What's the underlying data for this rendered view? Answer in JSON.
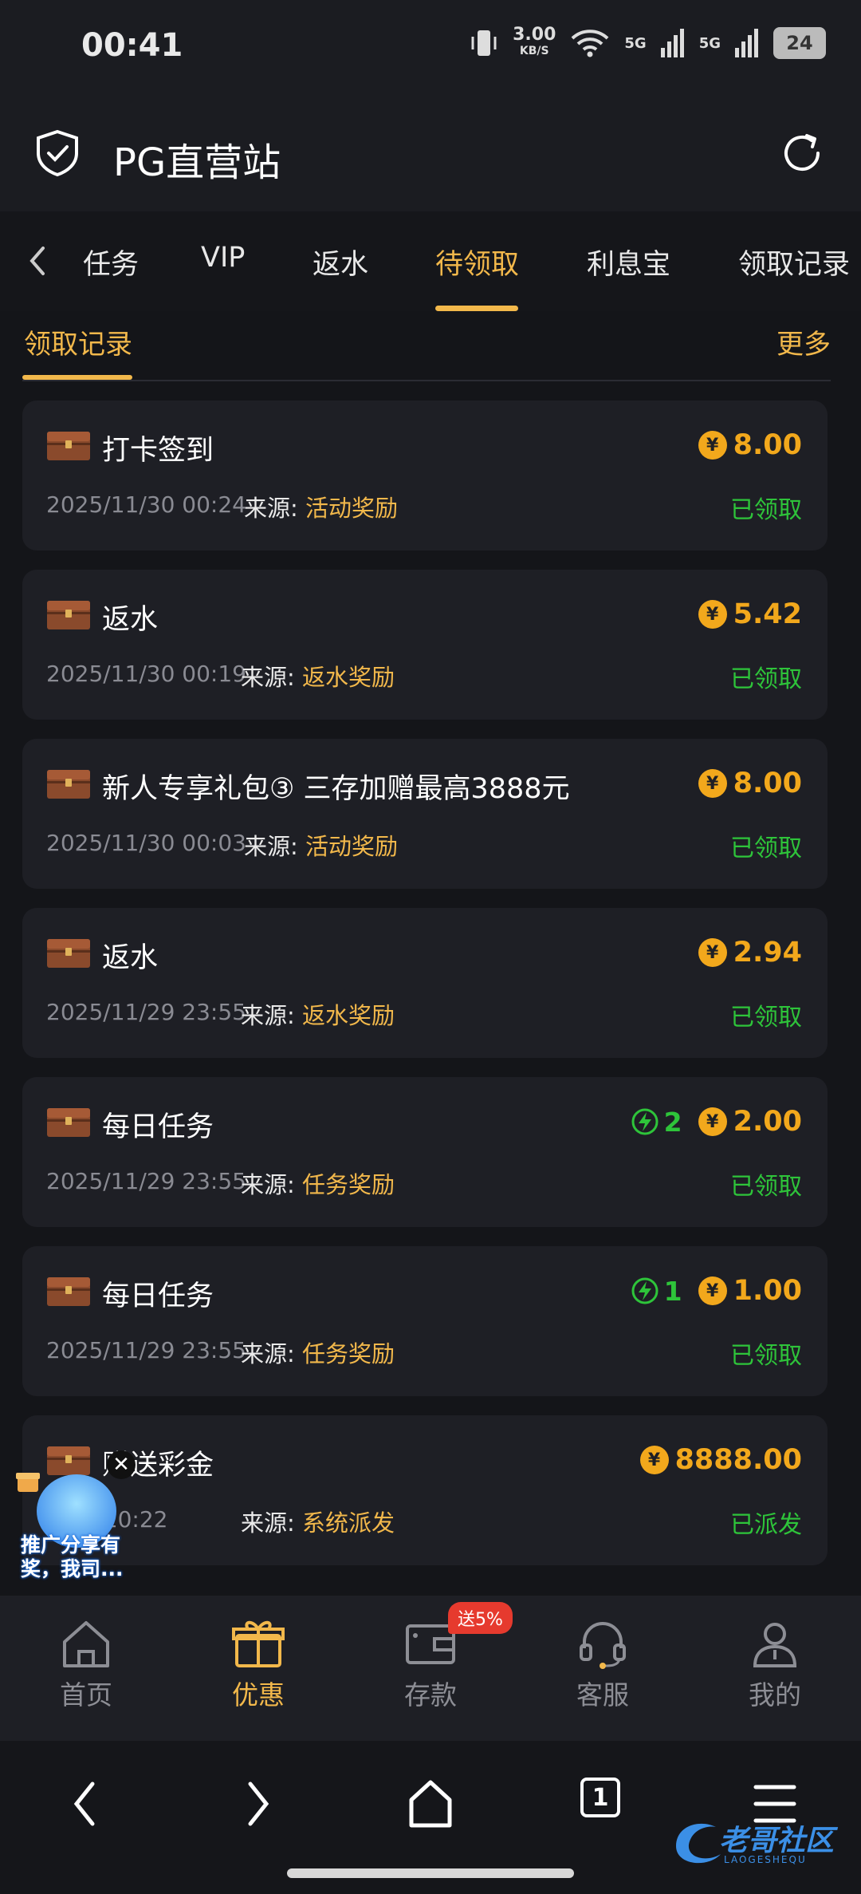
{
  "status_bar": {
    "time": "00:41",
    "net_speed": "3.00",
    "net_unit": "KB/S",
    "sig1": "5G",
    "sig2": "5G",
    "battery": "24"
  },
  "header": {
    "title": "PG直营站"
  },
  "tabs": [
    {
      "label": "任务"
    },
    {
      "label": "VIP"
    },
    {
      "label": "返水"
    },
    {
      "label": "待领取",
      "active": true
    },
    {
      "label": "利息宝"
    },
    {
      "label": "领取记录"
    }
  ],
  "section": {
    "title": "领取记录",
    "more": "更多"
  },
  "records": [
    {
      "title": "打卡签到",
      "date": "2025/11/30 00:24",
      "source_label": "来源:",
      "source": "活动奖励",
      "amount": "8.00",
      "points": "",
      "status": "已领取"
    },
    {
      "title": "返水",
      "date": "2025/11/30 00:19",
      "source_label": "来源:",
      "source": "返水奖励",
      "amount": "5.42",
      "points": "",
      "status": "已领取"
    },
    {
      "title": "新人专享礼包③ 三存加赠最高3888元",
      "date": "2025/11/30 00:03",
      "source_label": "来源:",
      "source": "活动奖励",
      "amount": "8.00",
      "points": "",
      "status": "已领取"
    },
    {
      "title": "返水",
      "date": "2025/11/29 23:55",
      "source_label": "来源:",
      "source": "返水奖励",
      "amount": "2.94",
      "points": "",
      "status": "已领取"
    },
    {
      "title": "每日任务",
      "date": "2025/11/29 23:55",
      "source_label": "来源:",
      "source": "任务奖励",
      "amount": "2.00",
      "points": "2",
      "status": "已领取"
    },
    {
      "title": "每日任务",
      "date": "2025/11/29 23:55",
      "source_label": "来源:",
      "source": "任务奖励",
      "amount": "1.00",
      "points": "1",
      "status": "已领取"
    },
    {
      "title": "赠送彩金",
      "date": "0/22 10:22",
      "source_label": "来源:",
      "source": "系统派发",
      "amount": "8888.00",
      "points": "",
      "status": "已派发"
    }
  ],
  "currency_symbol": "¥",
  "bottom_nav": [
    {
      "label": "首页",
      "icon": "home-icon"
    },
    {
      "label": "优惠",
      "icon": "gift-icon",
      "active": true
    },
    {
      "label": "存款",
      "icon": "wallet-icon"
    },
    {
      "label": "客服",
      "icon": "headset-icon"
    },
    {
      "label": "我的",
      "icon": "user-icon"
    }
  ],
  "deposit_badge": "送5%",
  "floating_ad": {
    "text": "推广分享有奖，我司..."
  },
  "system_nav": {
    "tab_count": "1"
  },
  "watermark": {
    "text": "老哥社区",
    "sub": "LAOGESHEQU"
  },
  "colors": {
    "accent": "#f2b84b",
    "amount": "#f2a81c",
    "success": "#2ec43a",
    "background": "#141519",
    "card": "#1e1f25"
  }
}
